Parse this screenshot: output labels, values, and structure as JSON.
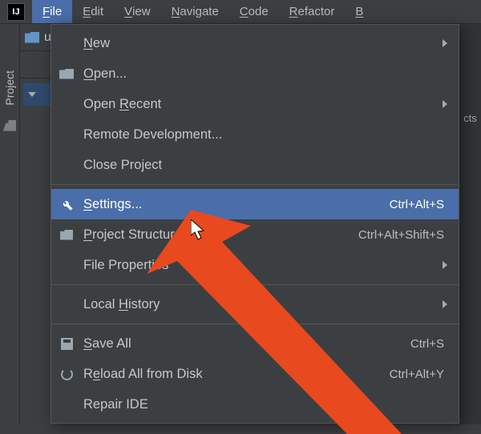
{
  "menubar": {
    "items": [
      {
        "label": "File",
        "mn": "F",
        "active": true
      },
      {
        "label": "Edit",
        "mn": "E"
      },
      {
        "label": "View",
        "mn": "V"
      },
      {
        "label": "Navigate",
        "mn": "N"
      },
      {
        "label": "Code",
        "mn": "C"
      },
      {
        "label": "Refactor",
        "mn": "R"
      },
      {
        "label": "B",
        "mn": "B",
        "partial": true
      }
    ]
  },
  "topbar": {
    "project_label_partial": "ui"
  },
  "tool_stripe": {
    "project_tab": "Project"
  },
  "right_edge_partial": "cts",
  "dropdown": {
    "items": [
      {
        "label": "New",
        "mn": "N",
        "submenu": true
      },
      {
        "label": "Open...",
        "mn": "O",
        "icon": "folder"
      },
      {
        "label": "Open Recent",
        "mn": "R",
        "submenu": true
      },
      {
        "label": "Remote Development..."
      },
      {
        "label": "Close Project",
        "mn": "j"
      },
      {
        "sep": true
      },
      {
        "label": "Settings...",
        "mn": "S",
        "icon": "wrench",
        "shortcut": "Ctrl+Alt+S",
        "highlight": true
      },
      {
        "label": "Project Structure...",
        "mn": "P",
        "icon": "struct",
        "shortcut": "Ctrl+Alt+Shift+S"
      },
      {
        "label": "File Properties",
        "submenu": true
      },
      {
        "sep": true
      },
      {
        "label": "Local History",
        "mn": "H",
        "submenu": true
      },
      {
        "sep": true
      },
      {
        "label": "Save All",
        "mn": "S",
        "icon": "save",
        "shortcut": "Ctrl+S"
      },
      {
        "label": "Reload All from Disk",
        "mn": "e",
        "icon": "reload",
        "shortcut": "Ctrl+Alt+Y"
      },
      {
        "label": "Repair IDE"
      }
    ]
  }
}
